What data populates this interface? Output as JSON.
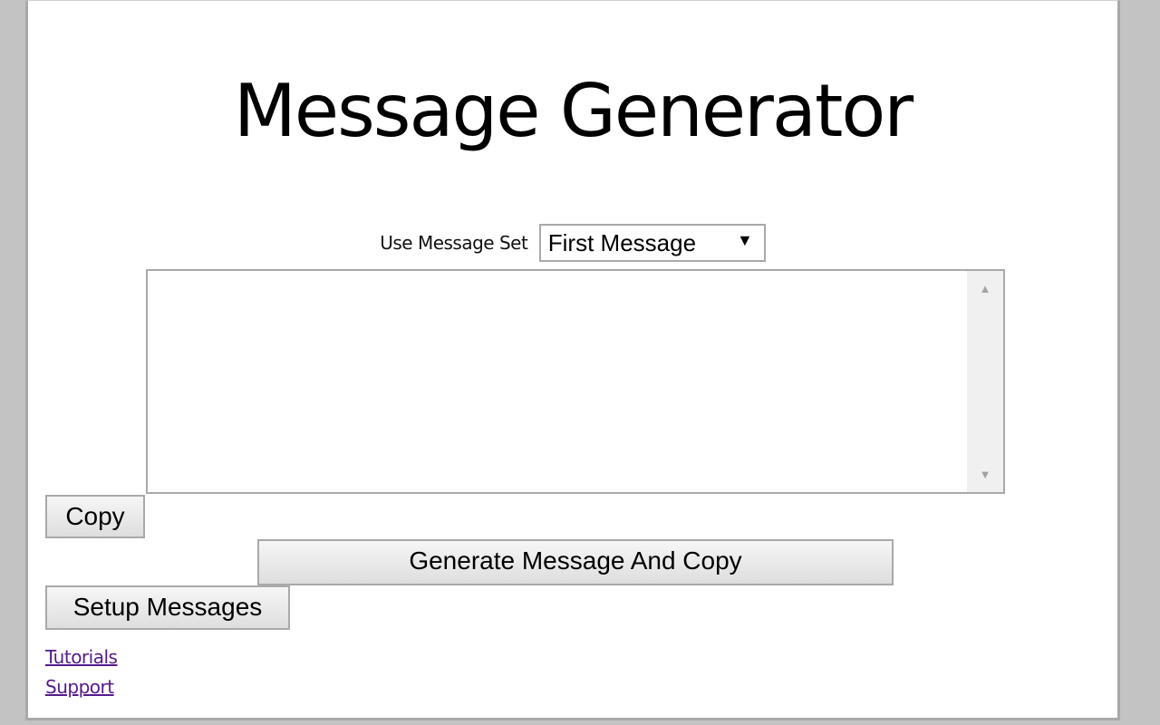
{
  "title": "Message Generator",
  "message_set": {
    "label": "Use Message Set",
    "selected": "First Message",
    "arrow": "▼"
  },
  "message_textarea": {
    "value": "",
    "scroll_up": "▲",
    "scroll_down": "▼"
  },
  "buttons": {
    "copy": "Copy",
    "generate": "Generate Message And Copy",
    "setup": "Setup Messages"
  },
  "links": {
    "tutorials": "Tutorials",
    "support": "Support"
  },
  "colors": {
    "link_visited": "#551a8b",
    "border": "#a9a9a9",
    "background_overlay": "#c3c3c3"
  }
}
